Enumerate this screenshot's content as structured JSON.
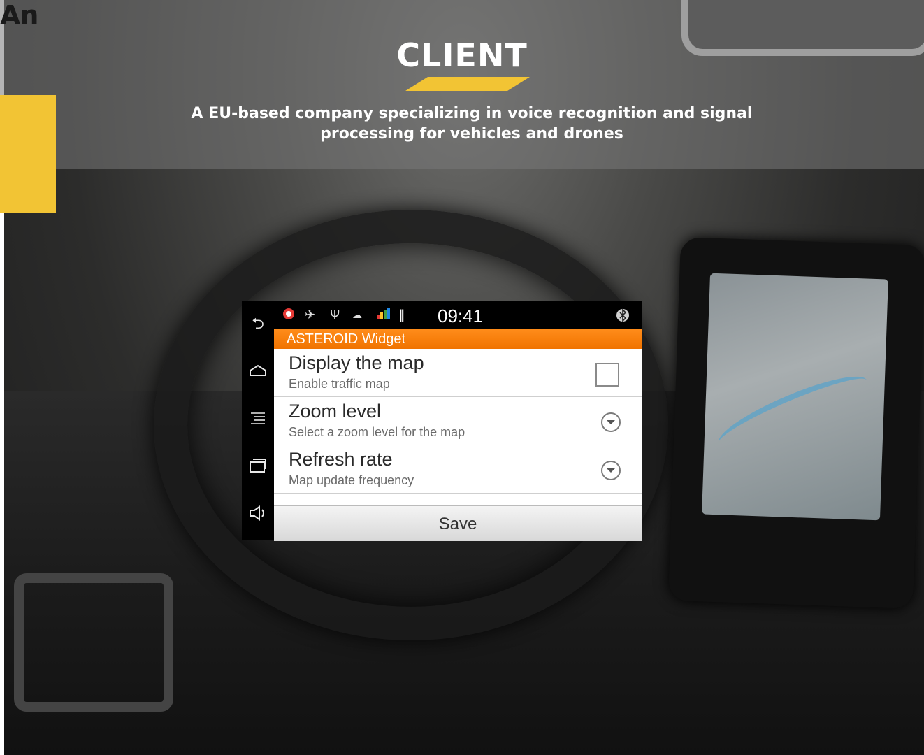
{
  "header": {
    "badge_text": "An",
    "title": "CLIENT",
    "description_line1": "A  EU-based company specializing in voice recognition and signal",
    "description_line2": "processing for vehicles and drones"
  },
  "colors": {
    "accent_yellow": "#f2c434",
    "titlebar_orange": "#f57c00"
  },
  "device": {
    "navbar": {
      "back_icon": "back-arrow-icon",
      "home_icon": "home-icon",
      "menu_icon": "menu-icon",
      "recents_icon": "recent-apps-icon",
      "volume_icon": "volume-icon"
    },
    "statusbar": {
      "time": "09:41",
      "icons": [
        "record-icon",
        "gps-icon",
        "usb-icon",
        "android-debug-icon",
        "signal-bars-icon",
        "pause-icon",
        "bluetooth-icon"
      ]
    },
    "app_title": "ASTEROID Widget",
    "preferences": [
      {
        "title": "Display the map",
        "summary": "Enable traffic map",
        "control": "checkbox",
        "checked": false
      },
      {
        "title": "Zoom level",
        "summary": "Select a zoom level for the map",
        "control": "dropdown"
      },
      {
        "title": "Refresh rate",
        "summary": "Map update frequency",
        "control": "dropdown"
      }
    ],
    "save_label": "Save"
  }
}
